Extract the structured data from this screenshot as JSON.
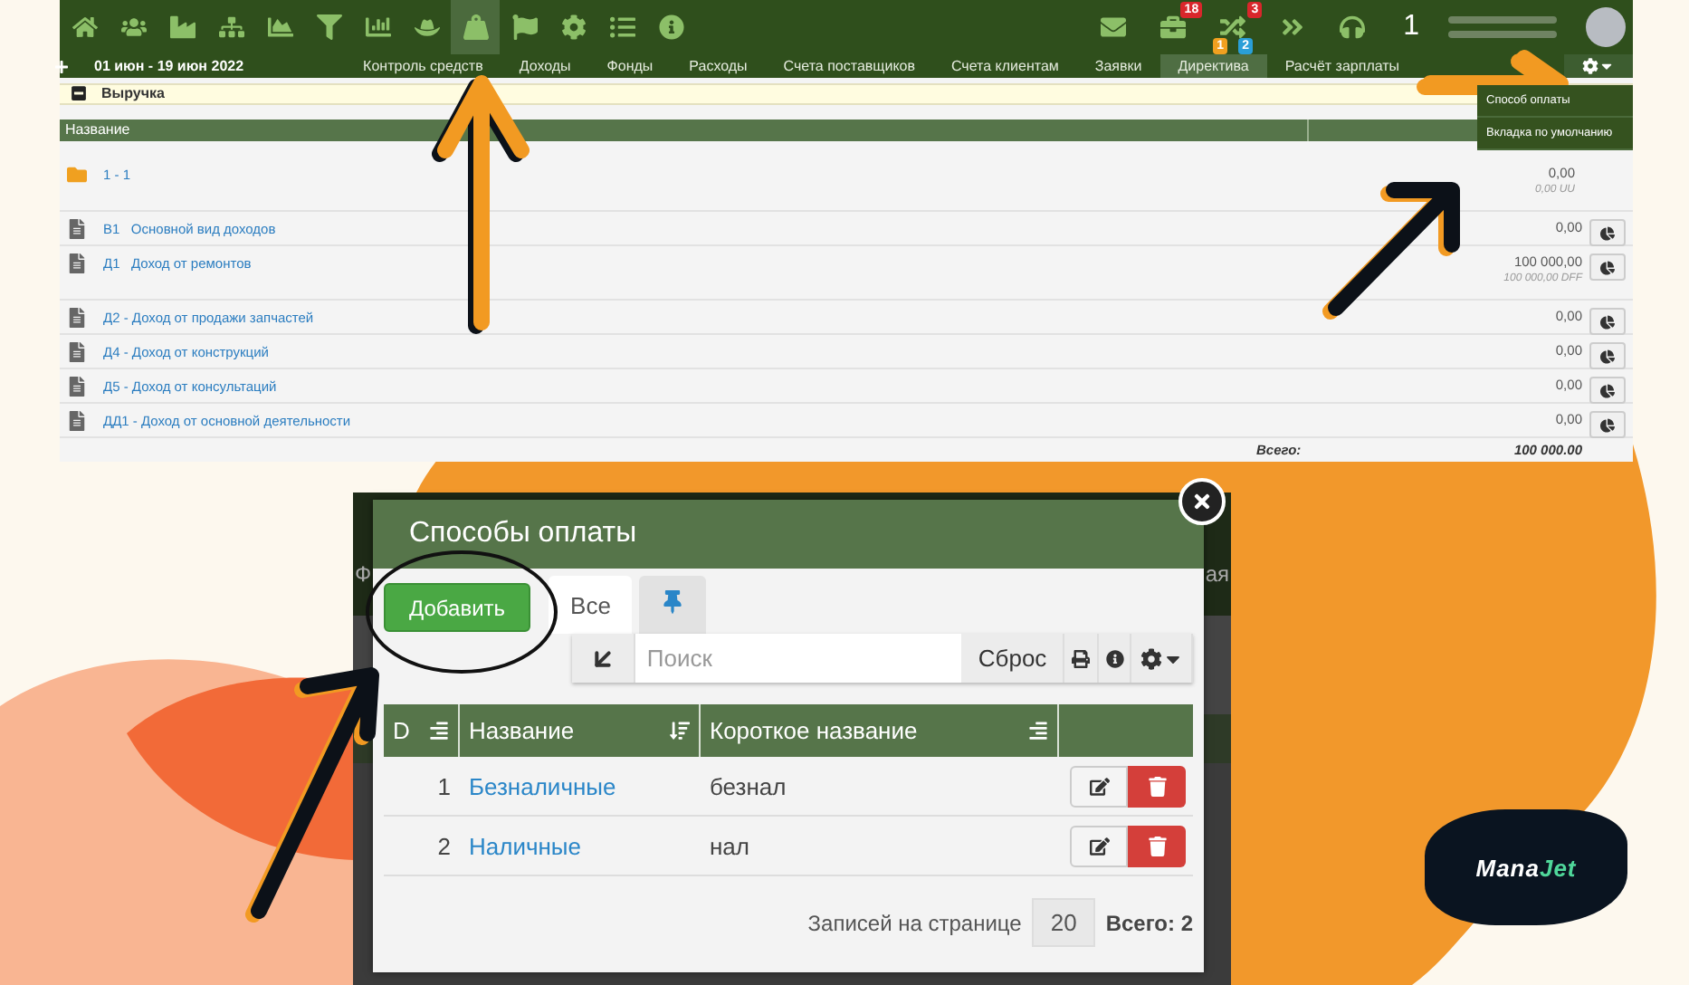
{
  "top_screenshot": {
    "toolbar_icons": [
      {
        "kind": "home",
        "selected": false
      },
      {
        "kind": "users",
        "selected": false
      },
      {
        "kind": "factory",
        "selected": false
      },
      {
        "kind": "sitemap",
        "selected": false
      },
      {
        "kind": "area",
        "selected": false
      },
      {
        "kind": "filter",
        "selected": false
      },
      {
        "kind": "bars",
        "selected": false
      },
      {
        "kind": "hat",
        "selected": false
      },
      {
        "kind": "weight",
        "selected": true
      },
      {
        "kind": "flag",
        "selected": false
      },
      {
        "kind": "gear",
        "selected": false
      },
      {
        "kind": "list",
        "selected": false
      },
      {
        "kind": "info",
        "selected": false
      }
    ],
    "notifications": [
      {
        "kind": "mail"
      },
      {
        "kind": "briefcase",
        "badge": "18"
      },
      {
        "kind": "shuffle",
        "badge": "3",
        "sub_badges": [
          {
            "text": "1",
            "color": "#f0a020"
          },
          {
            "text": "2",
            "color": "#2a9fd8"
          }
        ]
      },
      {
        "kind": "forward"
      },
      {
        "kind": "headset"
      }
    ],
    "counter": "1",
    "date_range": "01 июн - 19 июн 2022",
    "nav_tabs": [
      {
        "label": "Контроль средств",
        "selected": false
      },
      {
        "label": "Доходы",
        "selected": false
      },
      {
        "label": "Фонды",
        "selected": false
      },
      {
        "label": "Расходы",
        "selected": false
      },
      {
        "label": "Счета поставщиков",
        "selected": false
      },
      {
        "label": "Счета клиентам",
        "selected": false
      },
      {
        "label": "Заявки",
        "selected": false
      },
      {
        "label": "Директива",
        "selected": true
      },
      {
        "label": "Расчёт зарплаты",
        "selected": false
      }
    ],
    "settings_menu": [
      "Способ оплаты",
      "Вкладка по умолчанию"
    ],
    "section": {
      "title": "Выручка",
      "expanded": true
    },
    "table": {
      "columns": [
        "Название"
      ],
      "rows": [
        {
          "kind": "folder",
          "label": "1 - 1",
          "value": "0,00",
          "sub_value": "0,00 UU"
        },
        {
          "kind": "document",
          "label": "В1   Основной вид доходов",
          "value": "0,00"
        },
        {
          "kind": "document",
          "label": "Д1   Доход от ремонтов",
          "value": "100 000,00",
          "sub_value": "100 000,00 DFF"
        },
        {
          "kind": "document",
          "label": "Д2 - Доход от продажи запчастей",
          "value": "0,00"
        },
        {
          "kind": "document",
          "label": "Д4 - Доход от конструкций",
          "value": "0,00"
        },
        {
          "kind": "document",
          "label": "Д5 - Доход от консультаций",
          "value": "0,00"
        },
        {
          "kind": "document",
          "label": "ДД1 - Доход от основной деятельности",
          "value": "0,00"
        }
      ],
      "total_label": "Всего:",
      "total": "100 000.00"
    }
  },
  "dialog": {
    "title": "Способы оплаты",
    "add_button": "Добавить",
    "tabs": [
      {
        "kind": "text",
        "label": "Все",
        "selected": true
      },
      {
        "kind": "pin",
        "selected": false
      }
    ],
    "search": {
      "placeholder": "Поиск"
    },
    "reset_button": "Сброс",
    "columns": [
      "D",
      "Название",
      "Короткое название"
    ],
    "rows": [
      {
        "id": "1",
        "name": "Безналичные",
        "short": "безнал"
      },
      {
        "id": "2",
        "name": "Наличные",
        "short": "нал"
      }
    ],
    "per_page_label": "Записей на странице",
    "per_page": "20",
    "total": "Всего: 2"
  },
  "backdrop_fragments": [
    "Ф",
    "ая"
  ],
  "logo": {
    "parts": [
      "Mana",
      "Jet"
    ]
  }
}
